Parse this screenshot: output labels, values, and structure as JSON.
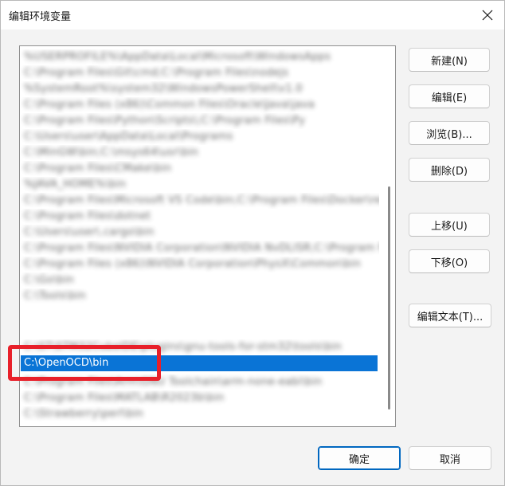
{
  "window": {
    "title": "编辑环境变量"
  },
  "list": {
    "blurred_rows": [
      "%USERPROFILE%\\AppData\\Local\\Microsoft\\WindowsApps",
      "C:\\Program Files\\Git\\cmd;C:\\Program Files\\nodejs",
      "%SystemRoot%\\system32\\WindowsPowerShell\\v1.0",
      "C:\\Program Files (x86)\\Common Files\\Oracle\\Java\\java",
      "C:\\Program Files\\Python\\Scripts\\;C:\\Program Files\\Py",
      "C:\\Users\\user\\AppData\\Local\\Programs",
      "C:\\MinGW\\bin;C:\\msys64\\usr\\bin",
      "C:\\Program Files\\CMake\\bin",
      "%JAVA_HOME%\\bin",
      "C:\\Program Files\\Microsoft VS Code\\bin;C:\\Program Files\\Docker\\resources\\bin",
      "C:\\Program Files\\dotnet",
      "C:\\Users\\user\\.cargo\\bin",
      "C:\\Program Files\\NVIDIA Corporation\\NVIDIA NvDLISR;C:\\Program Files",
      "C:\\Program Files (x86)\\NVIDIA Corporation\\PhysX\\Common\\bin",
      "C:\\Go\\bin",
      "C:\\Tools\\bin",
      "C:\\ST\\STM32CubeIDE\\plugins\\gnu-tools-for-stm32\\tools\\bin"
    ],
    "selected_row": "C:\\OpenOCD\\bin",
    "after_rows": [
      "C:\\Program Files\\Arm\\GNU Toolchain\\arm-none-eabi\\bin",
      "C:\\Program Files\\MATLAB\\R2023b\\bin",
      "C:\\Strawberry\\perl\\bin"
    ]
  },
  "buttons": {
    "new": "新建(N)",
    "edit": "编辑(E)",
    "browse": "浏览(B)...",
    "delete": "删除(D)",
    "move_up": "上移(U)",
    "move_down": "下移(O)",
    "edit_text": "编辑文本(T)...",
    "ok": "确定",
    "cancel": "取消"
  },
  "colors": {
    "selection": "#0a74d6",
    "highlight_box": "#e8202a",
    "default_button_border": "#0067c0"
  },
  "icons": {
    "close": "close-icon"
  }
}
